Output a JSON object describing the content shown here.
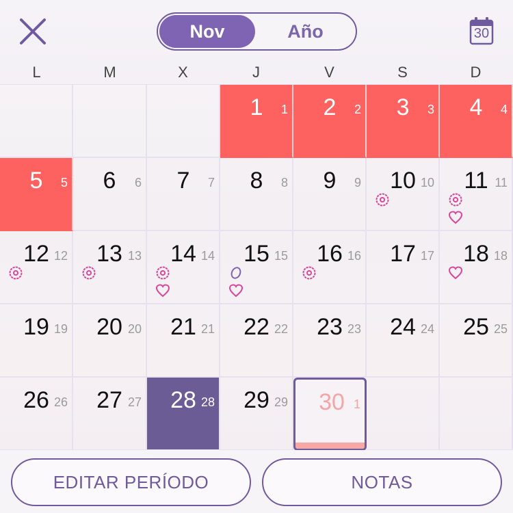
{
  "header": {
    "close_icon": "close-icon",
    "segment": {
      "active": "Nov",
      "inactive": "Año"
    },
    "calendar_button": {
      "icon": "calendar-icon",
      "number": "30"
    }
  },
  "weekdays": [
    "L",
    "M",
    "X",
    "J",
    "V",
    "S",
    "D"
  ],
  "colors": {
    "period": "#fd6261",
    "ovulation": "#6b5c96",
    "accent": "#7e64b3",
    "symptom_pink": "#d9479a",
    "today_bar": "#f6a8a6"
  },
  "days": [
    {
      "day": "1",
      "cycle": "1",
      "type": "period",
      "sym": []
    },
    {
      "day": "2",
      "cycle": "2",
      "type": "period",
      "sym": []
    },
    {
      "day": "3",
      "cycle": "3",
      "type": "period",
      "sym": []
    },
    {
      "day": "4",
      "cycle": "4",
      "type": "period",
      "sym": []
    },
    {
      "day": "5",
      "cycle": "5",
      "type": "period",
      "sym": []
    },
    {
      "day": "6",
      "cycle": "6",
      "type": "normal",
      "sym": []
    },
    {
      "day": "7",
      "cycle": "7",
      "type": "normal",
      "sym": []
    },
    {
      "day": "8",
      "cycle": "8",
      "type": "normal",
      "sym": []
    },
    {
      "day": "9",
      "cycle": "9",
      "type": "normal",
      "sym": []
    },
    {
      "day": "10",
      "cycle": "10",
      "type": "normal",
      "sym": [
        "flower"
      ]
    },
    {
      "day": "11",
      "cycle": "11",
      "type": "normal",
      "sym": [
        "flower",
        "heart"
      ]
    },
    {
      "day": "12",
      "cycle": "12",
      "type": "normal",
      "sym": [
        "flower"
      ]
    },
    {
      "day": "13",
      "cycle": "13",
      "type": "normal",
      "sym": [
        "flower"
      ]
    },
    {
      "day": "14",
      "cycle": "14",
      "type": "normal",
      "sym": [
        "flower",
        "heart"
      ]
    },
    {
      "day": "15",
      "cycle": "15",
      "type": "normal",
      "sym": [
        "egg",
        "heart"
      ]
    },
    {
      "day": "16",
      "cycle": "16",
      "type": "normal",
      "sym": [
        "flower"
      ]
    },
    {
      "day": "17",
      "cycle": "17",
      "type": "normal",
      "sym": []
    },
    {
      "day": "18",
      "cycle": "18",
      "type": "normal",
      "sym": [
        "heart"
      ]
    },
    {
      "day": "19",
      "cycle": "19",
      "type": "normal",
      "sym": []
    },
    {
      "day": "20",
      "cycle": "20",
      "type": "normal",
      "sym": []
    },
    {
      "day": "21",
      "cycle": "21",
      "type": "normal",
      "sym": []
    },
    {
      "day": "22",
      "cycle": "22",
      "type": "normal",
      "sym": []
    },
    {
      "day": "23",
      "cycle": "23",
      "type": "normal",
      "sym": []
    },
    {
      "day": "24",
      "cycle": "24",
      "type": "normal",
      "sym": []
    },
    {
      "day": "25",
      "cycle": "25",
      "type": "normal",
      "sym": []
    },
    {
      "day": "26",
      "cycle": "26",
      "type": "normal",
      "sym": []
    },
    {
      "day": "27",
      "cycle": "27",
      "type": "normal",
      "sym": []
    },
    {
      "day": "28",
      "cycle": "28",
      "type": "ovulation",
      "sym": []
    },
    {
      "day": "29",
      "cycle": "29",
      "type": "normal",
      "sym": []
    },
    {
      "day": "30",
      "cycle": "1",
      "type": "today",
      "sym": []
    }
  ],
  "footer": {
    "edit_label": "EDITAR PERÍODO",
    "notes_label": "NOTAS"
  }
}
